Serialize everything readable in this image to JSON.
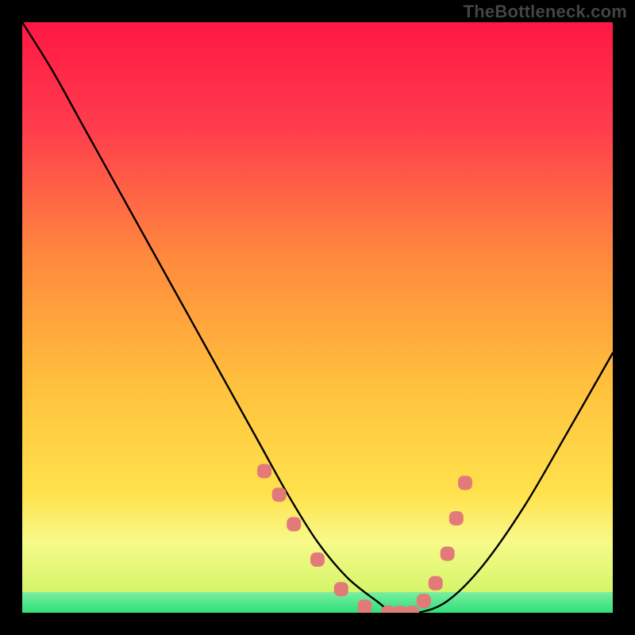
{
  "watermark": "TheBottleneck.com",
  "chart_data": {
    "type": "line",
    "title": "",
    "xlabel": "",
    "ylabel": "",
    "xlim": [
      0,
      100
    ],
    "ylim": [
      0,
      100
    ],
    "grid": false,
    "legend": false,
    "series": [
      {
        "name": "bottleneck-curve",
        "x": [
          0,
          5,
          10,
          15,
          20,
          25,
          30,
          35,
          40,
          45,
          50,
          55,
          60,
          63,
          67,
          72,
          78,
          85,
          92,
          100
        ],
        "y": [
          100,
          92,
          83,
          74,
          65,
          56,
          47,
          38,
          29,
          20,
          12,
          6,
          2,
          0,
          0,
          2,
          8,
          18,
          30,
          44
        ]
      }
    ],
    "highlight_points": {
      "name": "scatter-markers",
      "color": "#e27a7a",
      "x": [
        41,
        43.5,
        46,
        50,
        54,
        58,
        62,
        64,
        66,
        68,
        70,
        72,
        73.5,
        75
      ],
      "y": [
        24,
        20,
        15,
        9,
        4,
        1,
        0,
        0,
        0,
        2,
        5,
        10,
        16,
        22
      ]
    },
    "bands": [
      {
        "name": "green-band",
        "y0": 0,
        "y1": 3.5,
        "color0": "#2de07a",
        "color1": "#7bed9f"
      },
      {
        "name": "lime-band",
        "y0": 3.5,
        "y1": 12,
        "color0": "#d5f56a",
        "color1": "#f7fa8a"
      }
    ],
    "gradient_stops": [
      {
        "offset": 0,
        "color": "#ff1744"
      },
      {
        "offset": 18,
        "color": "#ff3d4d"
      },
      {
        "offset": 40,
        "color": "#ff8a3d"
      },
      {
        "offset": 62,
        "color": "#ffc23d"
      },
      {
        "offset": 80,
        "color": "#ffe24d"
      },
      {
        "offset": 88,
        "color": "#f7fa8a"
      },
      {
        "offset": 94,
        "color": "#d5f56a"
      },
      {
        "offset": 97,
        "color": "#7bed9f"
      },
      {
        "offset": 100,
        "color": "#2de07a"
      }
    ]
  }
}
